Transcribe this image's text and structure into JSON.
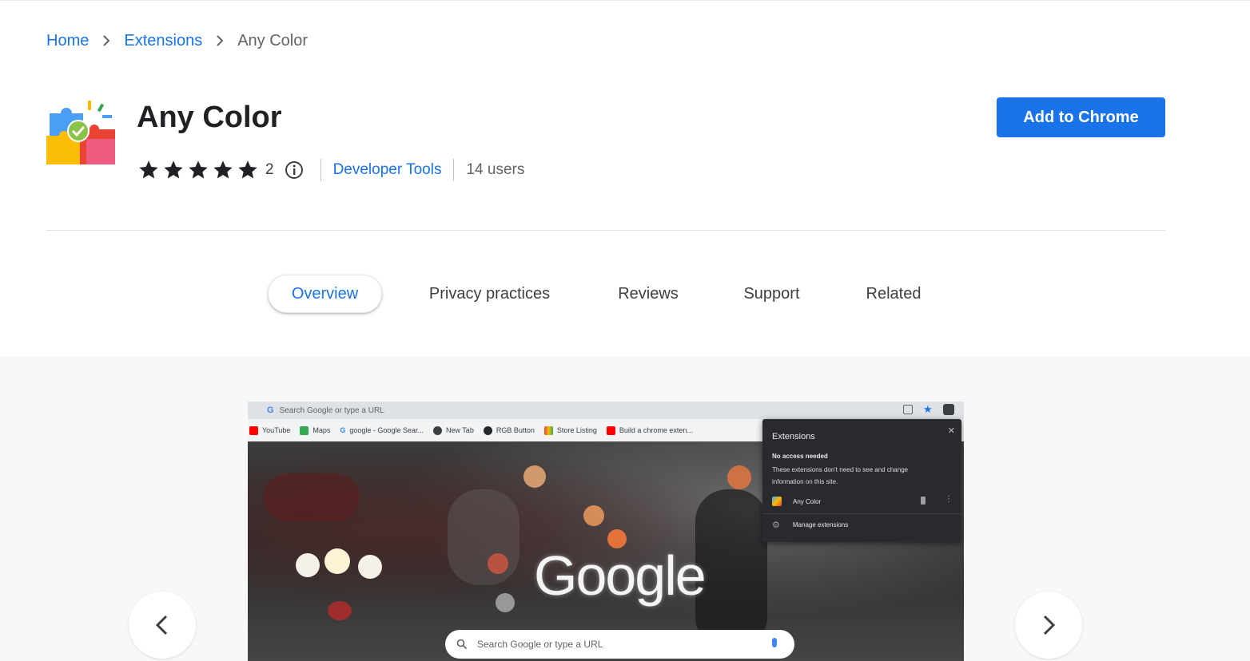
{
  "breadcrumb": {
    "home": "Home",
    "extensions": "Extensions",
    "current": "Any Color"
  },
  "extension": {
    "title": "Any Color",
    "rating_count": "2",
    "rating_stars": 5,
    "category": "Developer Tools",
    "users": "14 users"
  },
  "actions": {
    "add_label": "Add to Chrome"
  },
  "tabs": [
    {
      "label": "Overview",
      "active": true
    },
    {
      "label": "Privacy practices",
      "active": false
    },
    {
      "label": "Reviews",
      "active": false
    },
    {
      "label": "Support",
      "active": false
    },
    {
      "label": "Related",
      "active": false
    }
  ],
  "screenshot": {
    "omnibox": "Search Google or type a URL",
    "bookmarks": [
      "YouTube",
      "Maps",
      "google - Google Sear...",
      "New Tab",
      "RGB Button",
      "Store Listing",
      "Build a chrome exten..."
    ],
    "logo": "Google",
    "search_placeholder": "Search Google or type a URL",
    "popup": {
      "title": "Extensions",
      "subtitle": "No access needed",
      "desc_line1": "These extensions don't need to see and change",
      "desc_line2": "information on this site.",
      "item": "Any Color",
      "manage": "Manage extensions"
    }
  },
  "colors": {
    "accent": "#1a73e8",
    "text": "#202124",
    "muted": "#5f6368"
  }
}
